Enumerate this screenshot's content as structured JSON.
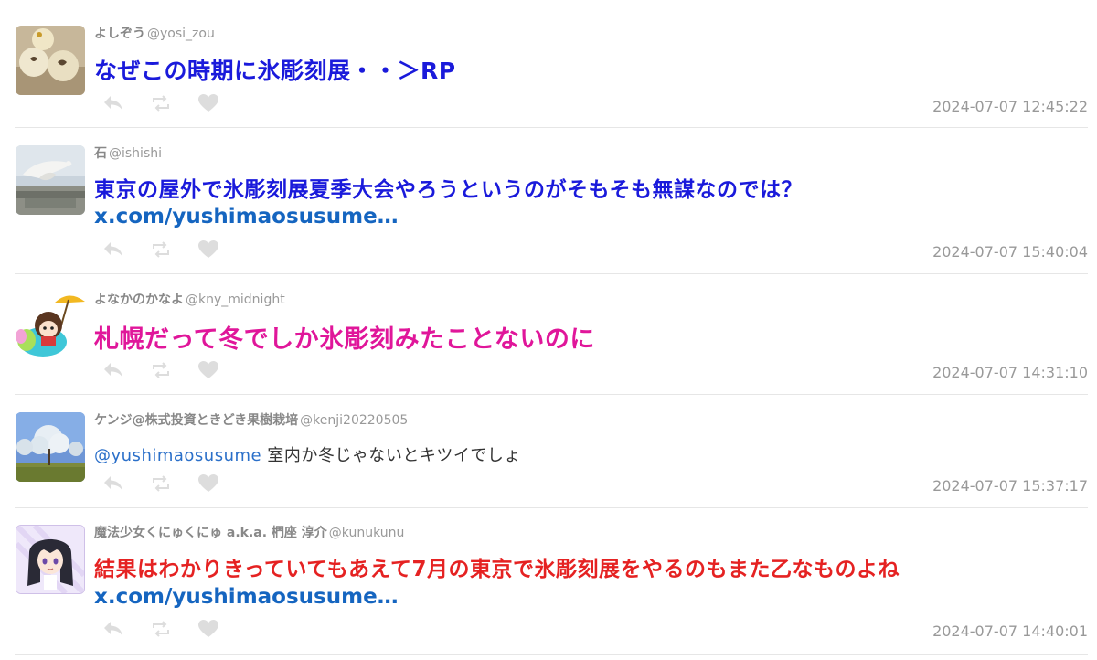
{
  "tweets": [
    {
      "name": "よしぞう",
      "handle": "@yosi_zou",
      "text": "なぜこの時期に氷彫刻展・・＞RP",
      "timestamp": "2024-07-07 12:45:22",
      "text_color": "#1a1adb",
      "avatar": "avatar-snack-photo"
    },
    {
      "name": "石",
      "handle": "@ishishi",
      "text": "東京の屋外で氷彫刻展夏季大会やろうというのがそもそも無謀なのでは？",
      "link": "x.com/yushimaosusume…",
      "timestamp": "2024-07-07 15:40:04",
      "text_color": "#1a1adb",
      "avatar": "avatar-bird-photo"
    },
    {
      "name": "よなかのかなよ",
      "handle": "@kny_midnight",
      "text": "札幌だって冬でしか氷彫刻みたことないのに",
      "timestamp": "2024-07-07 14:31:10",
      "text_color": "#e0169a",
      "avatar": "avatar-umbrella-girl"
    },
    {
      "name": "ケンジ@株式投資ときどき果樹栽培",
      "handle": "@kenji20220505",
      "mention": "@yushimaosusume",
      "text": " 室内か冬じゃないとキツイでしょ",
      "timestamp": "2024-07-07 15:37:17",
      "text_color": "#333333",
      "avatar": "avatar-tree-photo"
    },
    {
      "name": "魔法少女くにゅくにゅ a.k.a. 椚座 淳介",
      "handle": "@kunukunu",
      "text": "結果はわかりきっていてもあえて7月の東京で氷彫刻展をやるのもまた乙なものよね",
      "link": "x.com/yushimaosusume…",
      "timestamp": "2024-07-07 14:40:01",
      "text_color": "#e52222",
      "avatar": "avatar-anime-girl"
    }
  ],
  "actions": {
    "reply_icon": "reply-icon",
    "retweet_icon": "retweet-icon",
    "like_icon": "heart-icon",
    "icon_color": "#dddddd"
  }
}
